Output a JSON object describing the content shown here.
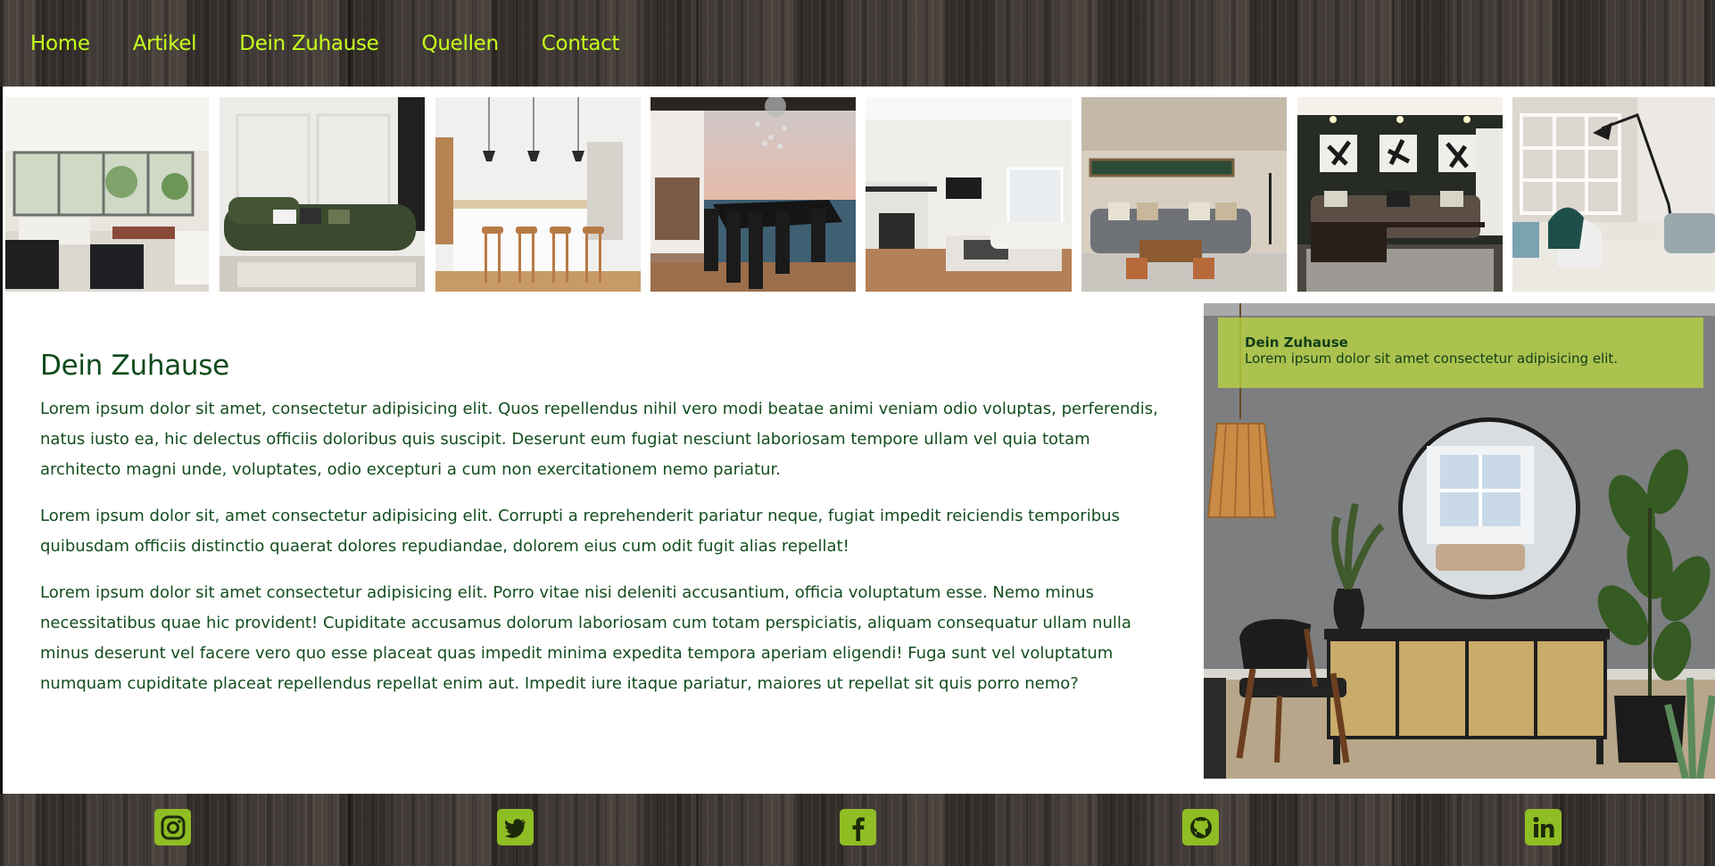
{
  "nav": {
    "items": [
      "Home",
      "Artikel",
      "Dein Zuhause",
      "Quellen",
      "Contact"
    ]
  },
  "gallery": {
    "images": [
      "living-room-sunroom-photo",
      "green-sofa-white-panel-photo",
      "white-kitchen-island-photo",
      "dining-room-sea-view-photo",
      "fireplace-living-room-photo",
      "grey-sofa-living-room-photo",
      "dark-green-lounge-photo",
      "loft-lounge-chairs-photo"
    ]
  },
  "article": {
    "title": "Dein Zuhause",
    "paragraphs": [
      "Lorem ipsum dolor sit amet, consectetur adipisicing elit. Quos repellendus nihil vero modi beatae animi veniam odio voluptas, perferendis, natus iusto ea, hic delectus officiis doloribus quis suscipit. Deserunt eum fugiat nesciunt laboriosam tempore ullam vel quia totam architecto magni unde, voluptates, odio excepturi a cum non exercitationem nemo pariatur.",
      "Lorem ipsum dolor sit, amet consectetur adipisicing elit. Corrupti a reprehenderit pariatur neque, fugiat impedit reiciendis temporibus quibusdam officiis distinctio quaerat dolores repudiandae, dolorem eius cum odit fugit alias repellat!",
      "Lorem ipsum dolor sit amet consectetur adipisicing elit. Porro vitae nisi deleniti accusantium, officia voluptatum esse. Nemo minus necessitatibus quae hic provident! Cupiditate accusamus dolorum laboriosam cum totam perspiciatis, aliquam consequatur ullam nulla minus deserunt vel facere vero quo esse placeat quas impedit minima expedita tempora aperiam eligendi! Fuga sunt vel voluptatum numquam cupiditate placeat repellendus repellat enim aut. Impedit iure itaque pariatur, maiores ut repellat sit quis porro nemo?"
    ]
  },
  "aside": {
    "image": "hallway-mirror-sideboard-photo",
    "caption_title": "Dein Zuhause",
    "caption_text": "Lorem ipsum dolor sit amet consectetur adipisicing elit."
  },
  "footer": {
    "icons": [
      "instagram-icon",
      "twitter-icon",
      "facebook-icon",
      "github-icon",
      "linkedin-icon"
    ]
  },
  "colors": {
    "nav_link": "#c6ff1a",
    "heading": "#0f4a1c",
    "body_text": "#134d1e",
    "social_icon_bg": "#8fbd24",
    "caption_bg": "#bedc3c"
  }
}
